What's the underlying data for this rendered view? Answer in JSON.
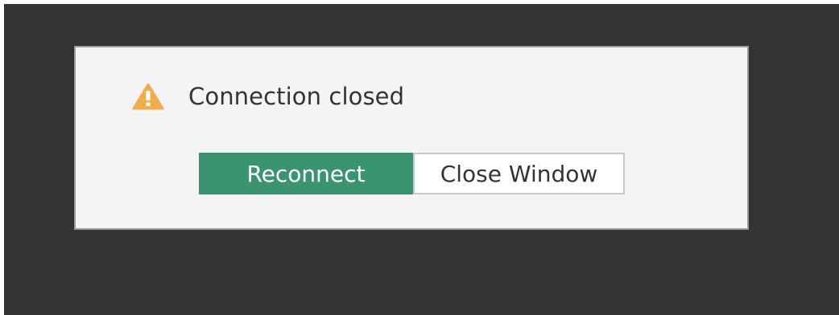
{
  "dialog": {
    "icon": "warning-icon",
    "message": "Connection closed",
    "buttons": {
      "reconnect_label": "Reconnect",
      "close_window_label": "Close Window"
    }
  },
  "colors": {
    "backdrop": "#333333",
    "dialog_background": "#f4f4f4",
    "warning": "#f0ad4e",
    "primary_button": "#3b9471",
    "secondary_button": "#ffffff"
  }
}
